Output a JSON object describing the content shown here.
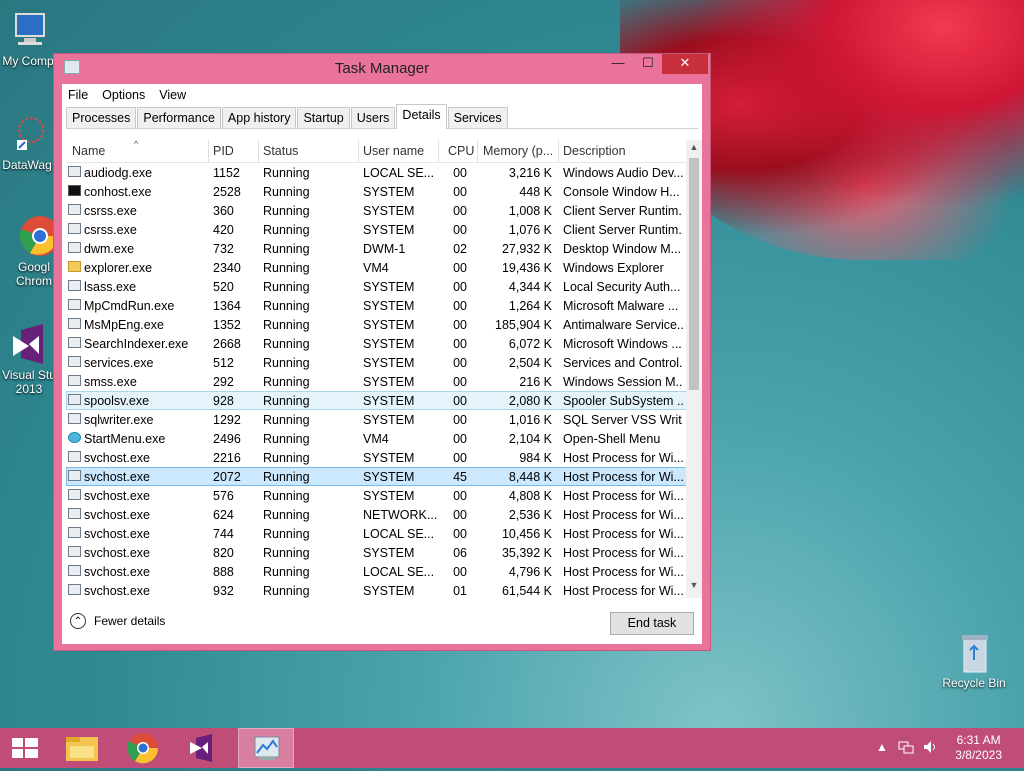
{
  "desktop": {
    "icons": [
      {
        "label": "My Comp"
      },
      {
        "label": "DataWag"
      },
      {
        "label": "Googl Chrom"
      },
      {
        "label": "Visual Stu 2013"
      },
      {
        "label": "Recycle Bin"
      }
    ]
  },
  "window": {
    "title": "Task Manager",
    "minimize": "—",
    "maximize": "☐",
    "close": "✕",
    "menu": [
      "File",
      "Options",
      "View"
    ],
    "tabs": [
      "Processes",
      "Performance",
      "App history",
      "Startup",
      "Users",
      "Details",
      "Services"
    ],
    "active_tab": "Details",
    "columns": [
      "Name",
      "PID",
      "Status",
      "User name",
      "CPU",
      "Memory (p...",
      "Description"
    ],
    "rows": [
      {
        "name": "audiodg.exe",
        "pid": "1152",
        "status": "Running",
        "user": "LOCAL SE...",
        "cpu": "00",
        "mem": "3,216 K",
        "desc": "Windows Audio Dev...",
        "icon": "window-icon"
      },
      {
        "name": "conhost.exe",
        "pid": "2528",
        "status": "Running",
        "user": "SYSTEM",
        "cpu": "00",
        "mem": "448 K",
        "desc": "Console Window H...",
        "icon": "console-icon"
      },
      {
        "name": "csrss.exe",
        "pid": "360",
        "status": "Running",
        "user": "SYSTEM",
        "cpu": "00",
        "mem": "1,008 K",
        "desc": "Client Server Runtim...",
        "icon": "window-icon"
      },
      {
        "name": "csrss.exe",
        "pid": "420",
        "status": "Running",
        "user": "SYSTEM",
        "cpu": "00",
        "mem": "1,076 K",
        "desc": "Client Server Runtim...",
        "icon": "window-icon"
      },
      {
        "name": "dwm.exe",
        "pid": "732",
        "status": "Running",
        "user": "DWM-1",
        "cpu": "02",
        "mem": "27,932 K",
        "desc": "Desktop Window M...",
        "icon": "window-icon"
      },
      {
        "name": "explorer.exe",
        "pid": "2340",
        "status": "Running",
        "user": "VM4",
        "cpu": "00",
        "mem": "19,436 K",
        "desc": "Windows Explorer",
        "icon": "folder-icon"
      },
      {
        "name": "lsass.exe",
        "pid": "520",
        "status": "Running",
        "user": "SYSTEM",
        "cpu": "00",
        "mem": "4,344 K",
        "desc": "Local Security Auth...",
        "icon": "window-icon"
      },
      {
        "name": "MpCmdRun.exe",
        "pid": "1364",
        "status": "Running",
        "user": "SYSTEM",
        "cpu": "00",
        "mem": "1,264 K",
        "desc": "Microsoft Malware ...",
        "icon": "window-icon"
      },
      {
        "name": "MsMpEng.exe",
        "pid": "1352",
        "status": "Running",
        "user": "SYSTEM",
        "cpu": "00",
        "mem": "185,904 K",
        "desc": "Antimalware Service...",
        "icon": "window-icon"
      },
      {
        "name": "SearchIndexer.exe",
        "pid": "2668",
        "status": "Running",
        "user": "SYSTEM",
        "cpu": "00",
        "mem": "6,072 K",
        "desc": "Microsoft Windows ...",
        "icon": "search-indexer-icon"
      },
      {
        "name": "services.exe",
        "pid": "512",
        "status": "Running",
        "user": "SYSTEM",
        "cpu": "00",
        "mem": "2,504 K",
        "desc": "Services and Control...",
        "icon": "window-icon"
      },
      {
        "name": "smss.exe",
        "pid": "292",
        "status": "Running",
        "user": "SYSTEM",
        "cpu": "00",
        "mem": "216 K",
        "desc": "Windows Session M...",
        "icon": "window-icon"
      },
      {
        "name": "spoolsv.exe",
        "pid": "928",
        "status": "Running",
        "user": "SYSTEM",
        "cpu": "00",
        "mem": "2,080 K",
        "desc": "Spooler SubSystem ...",
        "icon": "printer-icon"
      },
      {
        "name": "sqlwriter.exe",
        "pid": "1292",
        "status": "Running",
        "user": "SYSTEM",
        "cpu": "00",
        "mem": "1,016 K",
        "desc": "SQL Server VSS Writ...",
        "icon": "window-icon"
      },
      {
        "name": "StartMenu.exe",
        "pid": "2496",
        "status": "Running",
        "user": "VM4",
        "cpu": "00",
        "mem": "2,104 K",
        "desc": "Open-Shell Menu",
        "icon": "start-menu-icon"
      },
      {
        "name": "svchost.exe",
        "pid": "2216",
        "status": "Running",
        "user": "SYSTEM",
        "cpu": "00",
        "mem": "984 K",
        "desc": "Host Process for Wi...",
        "icon": "window-icon"
      },
      {
        "name": "svchost.exe",
        "pid": "2072",
        "status": "Running",
        "user": "SYSTEM",
        "cpu": "45",
        "mem": "8,448 K",
        "desc": "Host Process for Wi...",
        "icon": "window-icon"
      },
      {
        "name": "svchost.exe",
        "pid": "576",
        "status": "Running",
        "user": "SYSTEM",
        "cpu": "00",
        "mem": "4,808 K",
        "desc": "Host Process for Wi...",
        "icon": "window-icon"
      },
      {
        "name": "svchost.exe",
        "pid": "624",
        "status": "Running",
        "user": "NETWORK...",
        "cpu": "00",
        "mem": "2,536 K",
        "desc": "Host Process for Wi...",
        "icon": "window-icon"
      },
      {
        "name": "svchost.exe",
        "pid": "744",
        "status": "Running",
        "user": "LOCAL SE...",
        "cpu": "00",
        "mem": "10,456 K",
        "desc": "Host Process for Wi...",
        "icon": "window-icon"
      },
      {
        "name": "svchost.exe",
        "pid": "820",
        "status": "Running",
        "user": "SYSTEM",
        "cpu": "06",
        "mem": "35,392 K",
        "desc": "Host Process for Wi...",
        "icon": "window-icon"
      },
      {
        "name": "svchost.exe",
        "pid": "888",
        "status": "Running",
        "user": "LOCAL SE...",
        "cpu": "00",
        "mem": "4,796 K",
        "desc": "Host Process for Wi...",
        "icon": "window-icon"
      },
      {
        "name": "svchost.exe",
        "pid": "932",
        "status": "Running",
        "user": "SYSTEM",
        "cpu": "01",
        "mem": "61,544 K",
        "desc": "Host Process for Wi...",
        "icon": "window-icon"
      }
    ],
    "selected_pid": "2072",
    "hover_pid": "928",
    "fewer_details": "Fewer details",
    "end_task": "End task"
  },
  "taskbar": {
    "apps": [
      "start-icon",
      "file-explorer-icon",
      "chrome-icon",
      "visual-studio-icon",
      "task-manager-icon"
    ],
    "time": "6:31 AM",
    "date": "3/8/2023"
  },
  "colors": {
    "window_frame": "#e9739b",
    "taskbar": "#bf4d78",
    "selection": "#cce8ff"
  }
}
